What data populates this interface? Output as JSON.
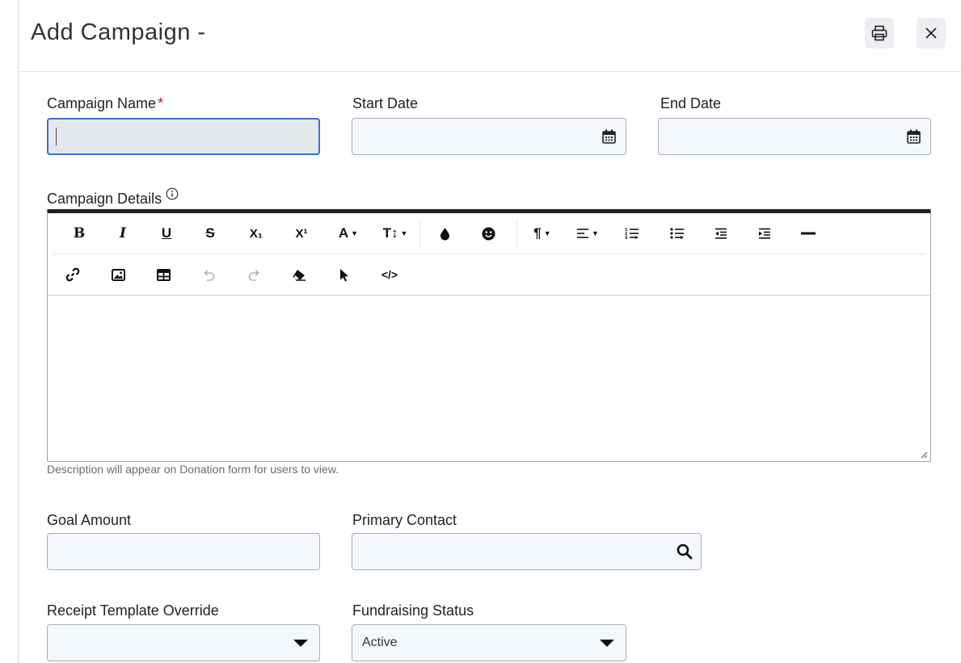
{
  "modal": {
    "title": "Add Campaign -"
  },
  "fields": {
    "campaign_name": {
      "label": "Campaign Name",
      "required_mark": "*",
      "value": ""
    },
    "start_date": {
      "label": "Start Date",
      "value": ""
    },
    "end_date": {
      "label": "End Date",
      "value": ""
    },
    "campaign_details": {
      "label": "Campaign Details",
      "info_icon": "info-circle-icon",
      "hint": "Description will appear on Donation form for users to view."
    },
    "goal_amount": {
      "label": "Goal Amount",
      "value": ""
    },
    "primary_contact": {
      "label": "Primary Contact",
      "value": ""
    },
    "receipt_template": {
      "label": "Receipt Template Override",
      "value": ""
    },
    "fundraising_status": {
      "label": "Fundraising Status",
      "value": "Active"
    }
  },
  "toolbar": {
    "row1": [
      {
        "name": "bold",
        "glyph": "B"
      },
      {
        "name": "italic",
        "glyph": "I"
      },
      {
        "name": "underline",
        "glyph": "U"
      },
      {
        "name": "strikethrough",
        "glyph": "S"
      },
      {
        "name": "subscript",
        "glyph": "X₁"
      },
      {
        "name": "superscript",
        "glyph": "X¹"
      },
      {
        "name": "font-color",
        "glyph": "A"
      },
      {
        "name": "font-size",
        "glyph": "T↕"
      },
      {
        "name": "background-color",
        "glyph": "💧"
      },
      {
        "name": "emoji",
        "glyph": "☻"
      },
      {
        "name": "paragraph",
        "glyph": "¶"
      },
      {
        "name": "align",
        "glyph": "≡"
      },
      {
        "name": "ordered-list",
        "glyph": "⒈"
      },
      {
        "name": "unordered-list",
        "glyph": "•"
      },
      {
        "name": "outdent",
        "glyph": "⇤"
      },
      {
        "name": "indent",
        "glyph": "⇥"
      },
      {
        "name": "horizontal-rule",
        "glyph": "—"
      }
    ],
    "row2": [
      {
        "name": "insert-link",
        "glyph": "🔗"
      },
      {
        "name": "insert-image",
        "glyph": "▣"
      },
      {
        "name": "insert-table",
        "glyph": "⊞"
      },
      {
        "name": "undo",
        "glyph": "↶"
      },
      {
        "name": "redo",
        "glyph": "↷"
      },
      {
        "name": "clear-format",
        "glyph": "⌫"
      },
      {
        "name": "select-all",
        "glyph": "➤"
      },
      {
        "name": "code-view",
        "glyph": "</>"
      }
    ]
  }
}
